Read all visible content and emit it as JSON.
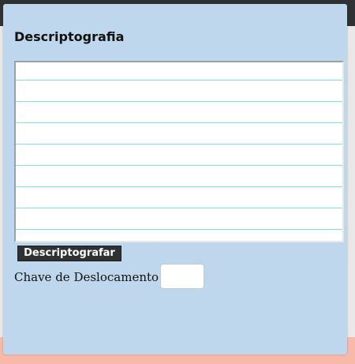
{
  "panel": {
    "title": "Descriptografia"
  },
  "textarea": {
    "value": ""
  },
  "button": {
    "label": "Descriptografar"
  },
  "shift_key": {
    "label": "Chave de Deslocamento",
    "value": ""
  },
  "colors": {
    "top_bar": "#2f3133",
    "bottom_bar": "#f9b9a8",
    "panel_background": "#bfd7ec",
    "textarea_rule_lines": "#7fe3e3",
    "button_background": "#2f3133",
    "button_text": "#ffffff"
  }
}
